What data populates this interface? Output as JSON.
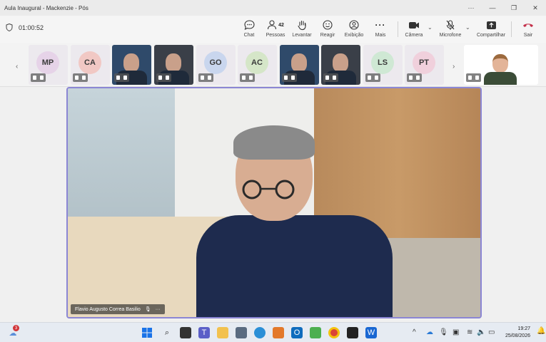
{
  "window": {
    "title": "Aula Inaugural - Mackenzie - Pós"
  },
  "toolbar": {
    "timer": "01:00:52",
    "chat": "Chat",
    "people": "Pessoas",
    "people_count": "42",
    "raise": "Levantar",
    "react": "Reagir",
    "view": "Exibição",
    "more": "Mais",
    "camera": "Câmera",
    "mic": "Microfone",
    "share": "Compartilhar",
    "leave": "Sair"
  },
  "participants": [
    {
      "initials": "MP",
      "color": "#e6d3e8",
      "video": false
    },
    {
      "initials": "CA",
      "color": "#f1c8c4",
      "video": false
    },
    {
      "initials": "",
      "color": "",
      "video": true
    },
    {
      "initials": "",
      "color": "",
      "video": true
    },
    {
      "initials": "GO",
      "color": "#c9d6ee",
      "video": false
    },
    {
      "initials": "AC",
      "color": "#d5e6c8",
      "video": false
    },
    {
      "initials": "",
      "color": "",
      "video": true
    },
    {
      "initials": "",
      "color": "",
      "video": true
    },
    {
      "initials": "LS",
      "color": "#cfe8d4",
      "video": false
    },
    {
      "initials": "PT",
      "color": "#f0d0dc",
      "video": false
    }
  ],
  "stage": {
    "speaker_name": "Flavio Augusto Correa Basilio"
  },
  "taskbar": {
    "badge_count": "3",
    "time": "19:27",
    "date": "25/08/2026"
  },
  "colors": {
    "accent": "#8b86d4",
    "leave": "#c4314b"
  }
}
